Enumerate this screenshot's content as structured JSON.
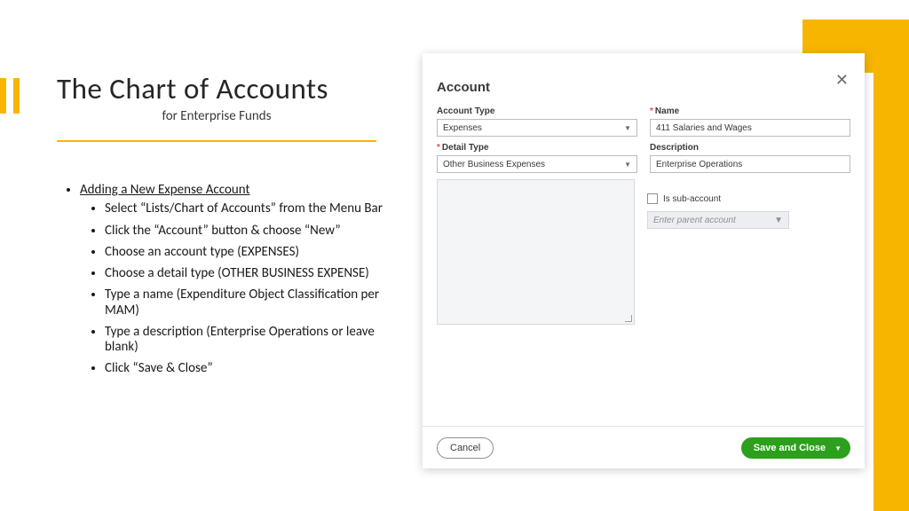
{
  "title": "The Chart of Accounts",
  "subtitle": "for Enterprise Funds",
  "bullet_heading": "Adding a New Expense Account",
  "bullets": [
    "Select “Lists/Chart of Accounts” from the Menu Bar",
    "Click the “Account” button & choose “New”",
    "Choose an account type (EXPENSES)",
    "Choose a detail type (OTHER BUSINESS EXPENSE)",
    "Type a name (Expenditure Object Classification per MAM)",
    "Type a description (Enterprise Operations or leave blank)",
    "Click “Save & Close”"
  ],
  "dialog": {
    "title": "Account",
    "labels": {
      "account_type": "Account Type",
      "name": "Name",
      "detail_type": "Detail Type",
      "description": "Description",
      "is_sub": "Is sub-account",
      "parent_placeholder": "Enter parent account"
    },
    "values": {
      "account_type": "Expenses",
      "name": "411 Salaries and Wages",
      "detail_type": "Other Business Expenses",
      "description": "Enterprise Operations"
    },
    "buttons": {
      "cancel": "Cancel",
      "save": "Save and Close"
    }
  }
}
